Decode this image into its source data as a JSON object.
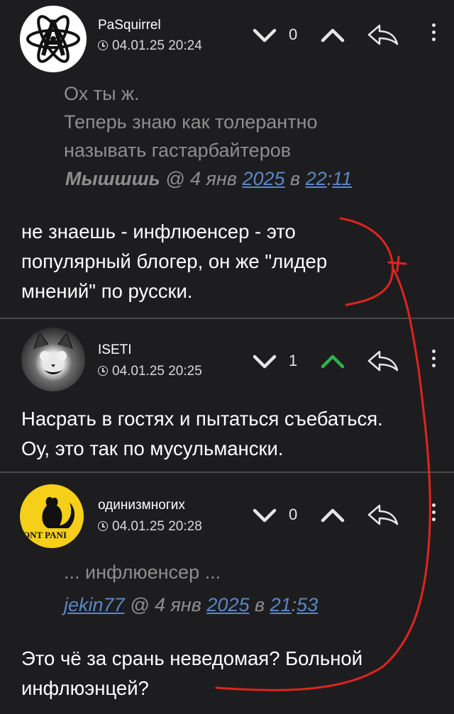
{
  "comments": [
    {
      "username": "PaSquirrel",
      "timestamp": "04.01.25 20:24",
      "votes": "0",
      "quote": {
        "lines": [
          "Ох ты ж.",
          "Теперь знаю как толерантно",
          "называть гастарбайтеров"
        ],
        "author": "Мышшшь",
        "at": "@ 4 янв",
        "year": "2025",
        "in": "в",
        "hour": "22",
        "colon": ":",
        "minute": "11"
      },
      "body": [
        "не знаешь - инфлюенсер - это",
        "популярный блогер, он же \"лидер",
        "мнений\" по русски."
      ]
    },
    {
      "username": "ISETI",
      "timestamp": "04.01.25 20:25",
      "votes": "1",
      "body": [
        "Насрать в гостях и пытаться съебаться.",
        "Оу, это так по мусульмански."
      ]
    },
    {
      "username": "одинизмногих",
      "timestamp": "04.01.25 20:28",
      "votes": "0",
      "avatar_text": "ONT PANI",
      "quote": {
        "lines": [
          "... инфлюенсер ..."
        ],
        "author": "jekin77",
        "at": "@ 4 янв",
        "year": "2025",
        "in": "в",
        "hour": "21",
        "colon": ":",
        "minute": "53"
      },
      "body": [
        "Это чё за срань неведомая? Больной",
        "инфлюэнцей?"
      ]
    }
  ],
  "icons": [
    "atom-icon",
    "clock-icon",
    "downvote-icon",
    "upvote-icon",
    "reply-icon",
    "more-icon"
  ],
  "colors": {
    "background": "#1d1d1f",
    "upvote_active": "#2fb24c",
    "link": "#5b86c6",
    "annotation": "#e0241f"
  }
}
